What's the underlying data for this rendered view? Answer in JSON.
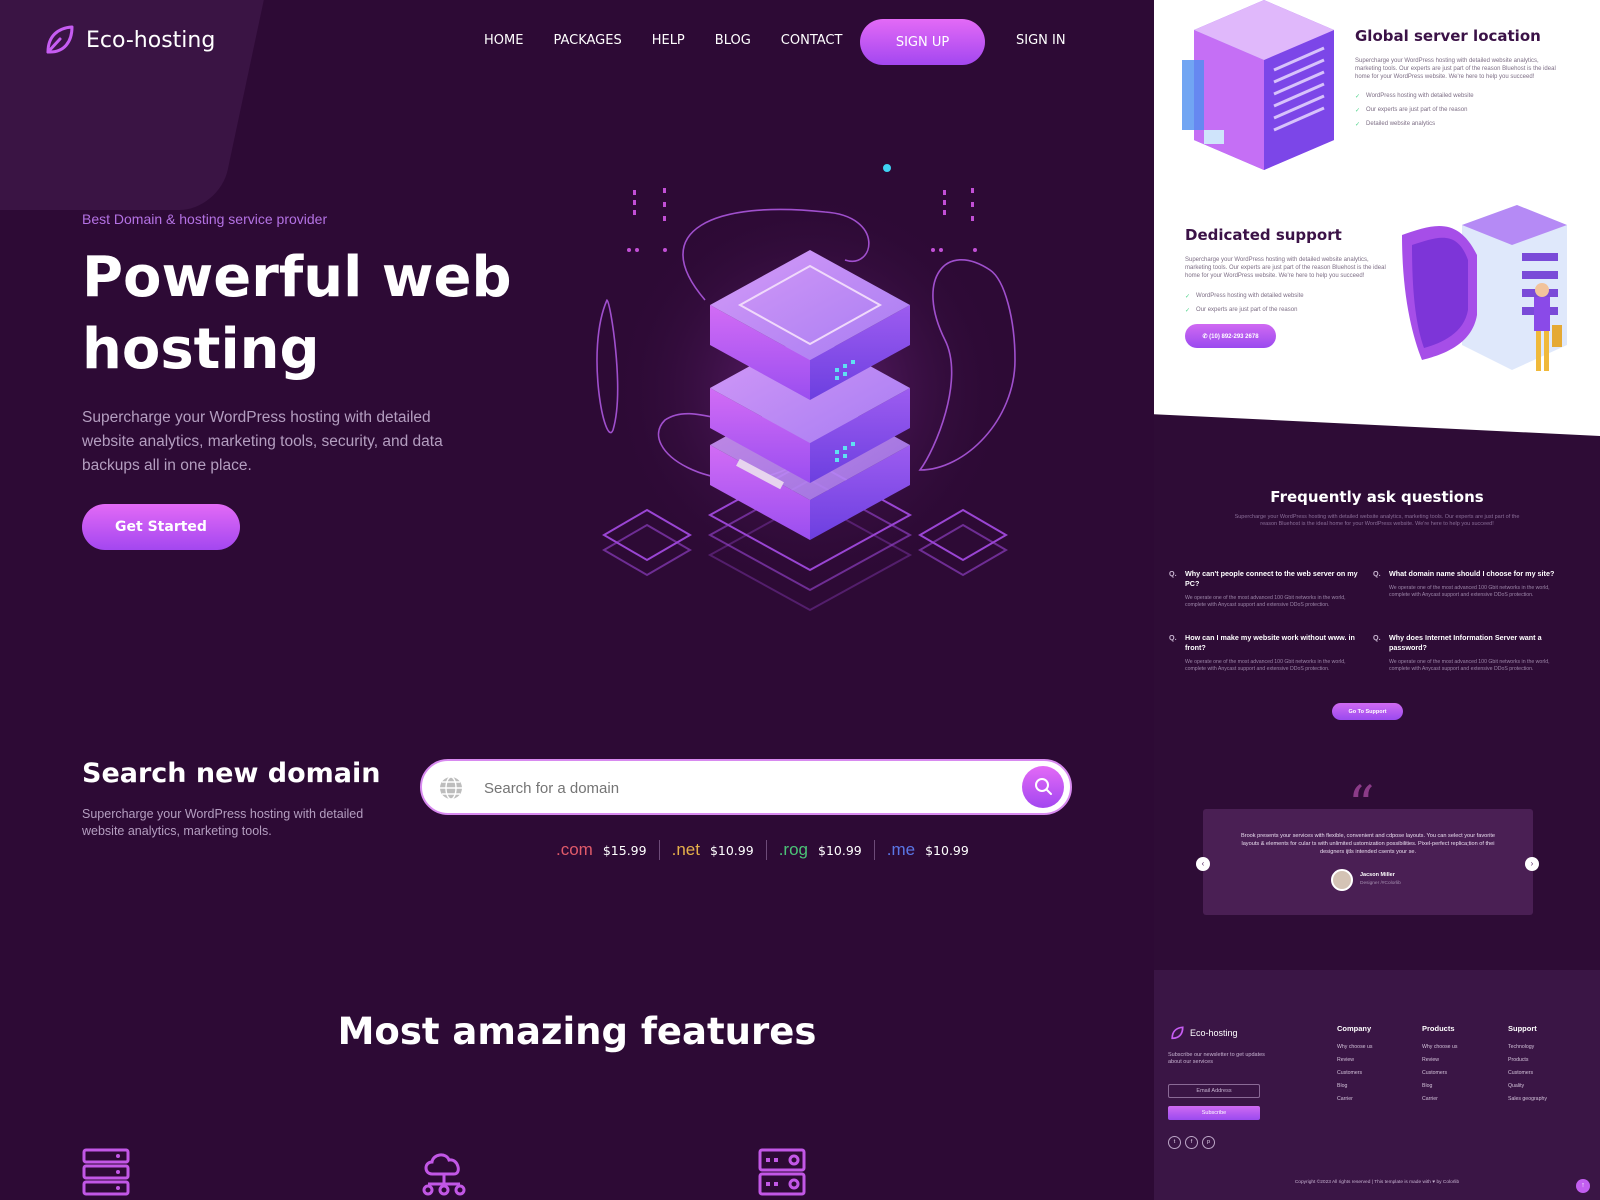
{
  "brand": {
    "name": "Eco-hosting"
  },
  "nav": {
    "items": [
      "HOME",
      "PACKAGES",
      "HELP",
      "BLOG",
      "CONTACT"
    ],
    "signup": "SIGN UP",
    "signin": "SIGN IN"
  },
  "hero": {
    "tagline": "Best Domain & hosting service provider",
    "title": "Powerful web hosting",
    "description": "Supercharge your WordPress hosting with detailed website analytics, marketing tools, security, and data backups all in one place.",
    "cta": "Get Started"
  },
  "domain_search": {
    "title": "Search new domain",
    "description": "Supercharge your WordPress hosting with detailed website analytics, marketing tools.",
    "placeholder": "Search for a domain",
    "tlds": [
      {
        "ext": ".com",
        "price": "$15.99",
        "color": "#e05a6a"
      },
      {
        "ext": ".net",
        "price": "$10.99",
        "color": "#e6b04a"
      },
      {
        "ext": ".rog",
        "price": "$10.99",
        "color": "#4bc377"
      },
      {
        "ext": ".me",
        "price": "$10.99",
        "color": "#5a76e6"
      }
    ]
  },
  "features": {
    "title": "Most amazing features"
  },
  "right": {
    "global": {
      "title": "Global server location",
      "desc": "Supercharge your WordPress hosting with detailed website analytics, marketing tools. Our experts are just part of the reason Bluehost is the ideal home for your WordPress website. We're here to help you succeed!",
      "items": [
        "WordPress hosting with detailed website",
        "Our experts are just part of the reason",
        "Detailed website analytics"
      ]
    },
    "support": {
      "title": "Dedicated support",
      "desc": "Supercharge your WordPress hosting with detailed website analytics, marketing tools. Our experts are just part of the reason Bluehost is the ideal home for your WordPress website. We're here to help you succeed!",
      "items": [
        "WordPress hosting with detailed website",
        "Our experts are just part of the reason"
      ],
      "phone": "(10) 892-293 2678"
    },
    "faq": {
      "title": "Frequently ask questions",
      "subtitle": "Supercharge your WordPress hosting with detailed website analytics, marketing tools. Our experts are just part of the reason Bluehost is the ideal home for your WordPress website. We're here to help you succeed!",
      "items": [
        {
          "q": "Why can't people connect to the web server on my PC?",
          "a": "We operate one of the most advanced 100 Gbit networks in the world, complete with Anycast support and extensive DDoS protection."
        },
        {
          "q": "What domain name should I choose for my site?",
          "a": "We operate one of the most advanced 100 Gbit networks in the world, complete with Anycast support and extensive DDoS protection."
        },
        {
          "q": "How can I make my website work without www. in front?",
          "a": "We operate one of the most advanced 100 Gbit networks in the world, complete with Anycast support and extensive DDoS protection."
        },
        {
          "q": "Why does Internet Information Server want a password?",
          "a": "We operate one of the most advanced 100 Gbit networks in the world, complete with Anycast support and extensive DDoS protection."
        }
      ],
      "marker": "Q.",
      "button": "Go To Support"
    },
    "testimonial": {
      "text": "Brook presents your services with flexible, convenient and cdpose layouts. You can select your favorite layouts & elements for cular ts with unlimited ustomization possibilities. Pixel-perfect replica;tion of thei designers ijtls intended csents your se.",
      "name": "Jacson Miller",
      "role": "Designer /#Colorlib"
    },
    "footer": {
      "brand": "Eco-hosting",
      "subscribe_text": "Subscribe our newsletter to get updates about our services",
      "email_placeholder": "Email Address",
      "subscribe_btn": "Subscribe",
      "columns": [
        {
          "title": "Company",
          "links": [
            "Why choose us",
            "Review",
            "Customers",
            "Blog",
            "Carrier"
          ]
        },
        {
          "title": "Products",
          "links": [
            "Why choose us",
            "Review",
            "Customers",
            "Blog",
            "Carrier"
          ]
        },
        {
          "title": "Support",
          "links": [
            "Technology",
            "Products",
            "Customers",
            "Quality",
            "Sales geography"
          ]
        }
      ],
      "copyright": "Copyright ©2023 All rights reserved | This template is made with ♥ by Colorlib"
    }
  }
}
